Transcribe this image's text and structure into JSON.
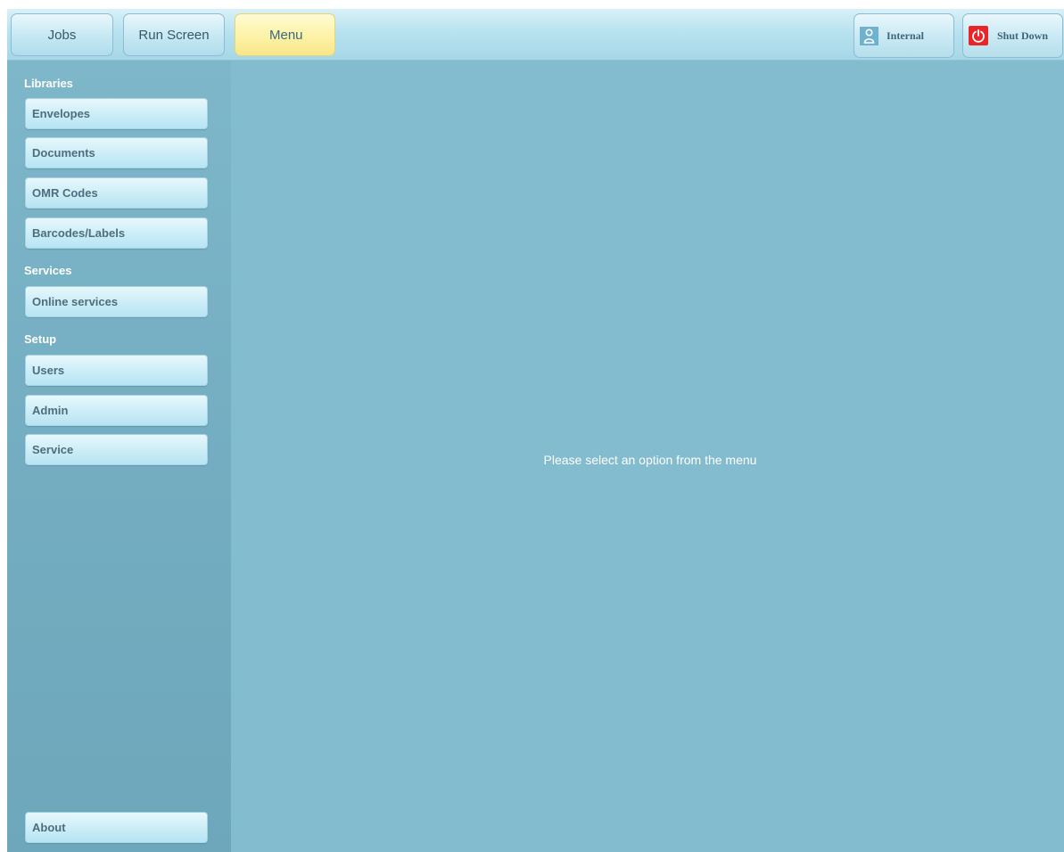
{
  "toolbar": {
    "tabs": [
      {
        "label": "Jobs"
      },
      {
        "label": "Run Screen"
      },
      {
        "label": "Menu"
      }
    ],
    "user_label": "Internal",
    "shutdown_label": "Shut Down"
  },
  "sidebar": {
    "sections": [
      {
        "title": "Libraries",
        "items": [
          "Envelopes",
          "Documents",
          "OMR Codes",
          "Barcodes/Labels"
        ]
      },
      {
        "title": "Services",
        "items": [
          "Online services"
        ]
      },
      {
        "title": "Setup",
        "items": [
          "Users",
          "Admin",
          "Service"
        ]
      }
    ],
    "about_label": "About"
  },
  "main": {
    "placeholder": "Please select an option from the menu"
  },
  "colors": {
    "active_tab": "#fdf1a2",
    "sidebar_bg": "#74adc1",
    "main_bg": "#83bccf",
    "shutdown_red": "#e8262a"
  }
}
